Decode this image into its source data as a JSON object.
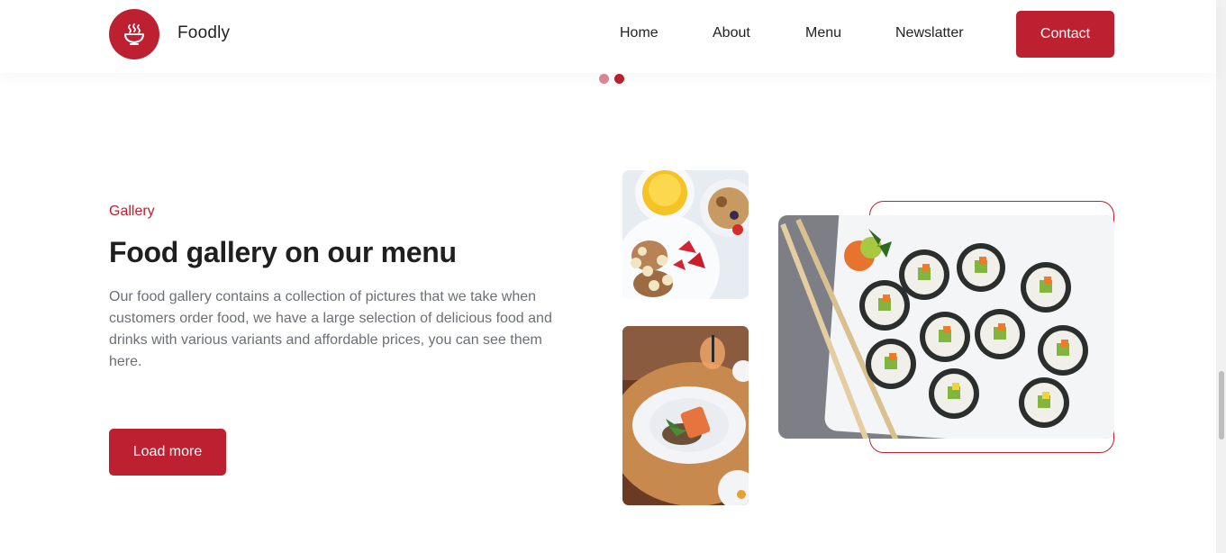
{
  "header": {
    "brand": "Foodly",
    "nav": [
      "Home",
      "About",
      "Menu",
      "Newslatter"
    ],
    "contact_label": "Contact",
    "logo_icon": "bowl-icon"
  },
  "slider": {
    "dots": 2,
    "active_index": 1
  },
  "gallery": {
    "eyebrow": "Gallery",
    "title": "Food gallery on our menu",
    "description": "Our food gallery contains a collection of pictures that we take when customers order food, we have a large selection of delicious food and drinks with various variants and affordable prices, you can see them here.",
    "load_more_label": "Load more"
  },
  "colors": {
    "accent": "#BD2031",
    "text": "#222222",
    "muted": "#6b6f76"
  },
  "images": [
    "breakfast-plate-image",
    "salmon-plate-image",
    "sushi-plate-image"
  ]
}
